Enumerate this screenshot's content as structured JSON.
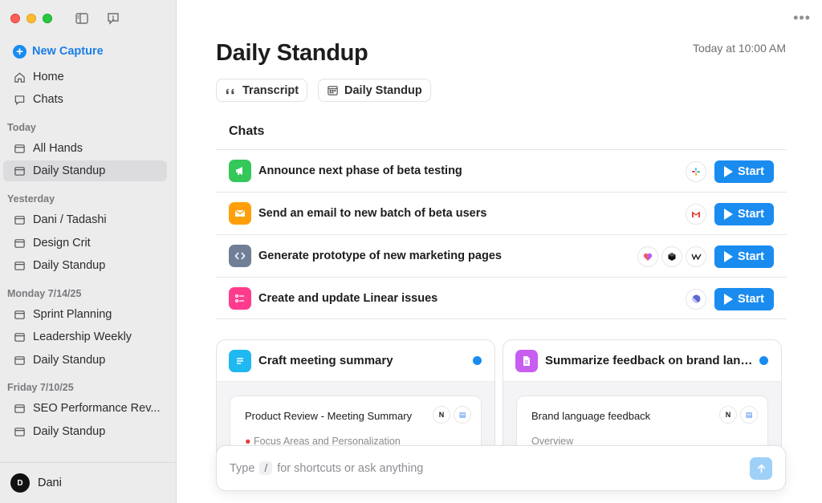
{
  "sidebar": {
    "new_capture": "New Capture",
    "home": "Home",
    "chats": "Chats",
    "sections": [
      {
        "label": "Today",
        "items": [
          "All Hands",
          "Daily Standup"
        ]
      },
      {
        "label": "Yesterday",
        "items": [
          "Dani / Tadashi",
          "Design Crit",
          "Daily Standup"
        ]
      },
      {
        "label": "Monday 7/14/25",
        "items": [
          "Sprint Planning",
          "Leadership Weekly",
          "Daily Standup"
        ]
      },
      {
        "label": "Friday 7/10/25",
        "items": [
          "SEO Performance Rev...",
          "Daily Standup"
        ]
      }
    ],
    "selected": "Today / Daily Standup",
    "user": {
      "initial": "D",
      "name": "Dani"
    }
  },
  "main": {
    "title": "Daily Standup",
    "timestamp": "Today at 10:00 AM",
    "chips": [
      "Transcript",
      "Daily Standup"
    ],
    "chats_heading": "Chats",
    "chats": [
      {
        "text": "Announce next phase of beta testing",
        "icon": "megaphone-icon",
        "color": "#34c759",
        "apps": [
          "slack-icon"
        ],
        "button": "Start"
      },
      {
        "text": "Send an email to new batch of beta users",
        "icon": "envelope-icon",
        "color": "#ff9f0a",
        "apps": [
          "gmail-icon"
        ],
        "button": "Start"
      },
      {
        "text": "Generate prototype of new marketing pages",
        "icon": "code-icon",
        "color": "#6e7f96",
        "apps": [
          "lovable-icon",
          "cube-icon",
          "webflow-icon"
        ],
        "button": "Start"
      },
      {
        "text": "Create and update Linear issues",
        "icon": "checklist-icon",
        "color": "#ff3b8e",
        "apps": [
          "linear-icon"
        ],
        "button": "Start"
      }
    ],
    "cards": [
      {
        "title": "Craft meeting summary",
        "icon": "document-lines-icon",
        "color": "#1fb8f0",
        "doc_title": "Product Review - Meeting Summary",
        "doc_sub": "Focus Areas and Personalization",
        "apps": [
          "notion-icon",
          "google-docs-icon"
        ]
      },
      {
        "title": "Summarize feedback on brand lang...",
        "icon": "document-icon",
        "color": "#c85ef0",
        "doc_title": "Brand language feedback",
        "doc_sub": "Overview",
        "apps": [
          "notion-icon",
          "google-docs-icon"
        ]
      }
    ],
    "composer": {
      "before": "Type",
      "slash": "/",
      "after": "for shortcuts or ask anything"
    }
  },
  "colors": {
    "accent": "#1a8cf0",
    "sidebar_bg": "#ececed"
  }
}
